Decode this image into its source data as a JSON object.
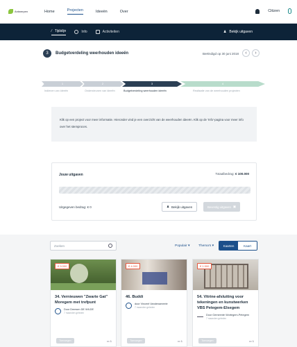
{
  "nav": {
    "logo_text": "Antwerpen",
    "items": [
      "Home",
      "Projecten",
      "Ideeën",
      "Over"
    ],
    "active": "Projecten",
    "user": "Citizen"
  },
  "subnav": {
    "tabs": [
      "Tijdslijn",
      "Info",
      "Activiteiten"
    ],
    "right": "Bekijk uitgaven"
  },
  "step": {
    "number": "3",
    "title": "Budgetverdeling weerhouden ideeën",
    "date": "Beëindigd op 30 juni 2018"
  },
  "phases": [
    {
      "n": "1",
      "label": "Indienen van ideeën"
    },
    {
      "n": "2",
      "label": "Ondersteunen van ideeën"
    },
    {
      "n": "3",
      "label": "Budgetverdeling weerhouden ideeën"
    },
    {
      "n": "4",
      "label": "Realisatie van de weerhouden projecten"
    }
  ],
  "info_text": "Klik op een project voor meer informatie. Hieronder vind je een overzicht van de weerhouden ideeën. Klik op de 'Info'-pagina voor meer info over het stemproces.",
  "expense": {
    "title": "Jouw uitgaven",
    "total_label": "Totaalbedrag",
    "total_value": "€ 100.000",
    "spent": "Uitgegeven bedrag: € 0",
    "view_button": "Bekijk uitgaven",
    "submit_button": "Bevestig uitgaven",
    "progress_fraction": 0
  },
  "filters": {
    "search_placeholder": "Zoeken",
    "sort": "Populair",
    "theme": "Thema's",
    "view_cards": "Kaarten",
    "view_map": "Kaart"
  },
  "cards": [
    {
      "price": "€ 9.000",
      "title": "34. Vernieuwen \"Zwarte Gat\" Moregem met trefpunt",
      "author": "Door Dreesen DE WILDE",
      "sub": "7 maanden geleden",
      "button": "Toevoegen",
      "count": "1"
    },
    {
      "price": "€ 4.000",
      "title": "46. Buddi",
      "author": "door Vincent Vandenameele",
      "sub": "7 maanden geleden",
      "button": "Toevoegen",
      "count": "1"
    },
    {
      "price": "€ 1.500",
      "title": "54. Vitrine-afsluiting voor tekeningen en kunstwerken VBS Petegem-Elsegem",
      "author": "Door Gemeente Wortegem-Petegem",
      "sub": "7 maanden geleden",
      "button": "Toevoegen",
      "count": "1"
    }
  ]
}
